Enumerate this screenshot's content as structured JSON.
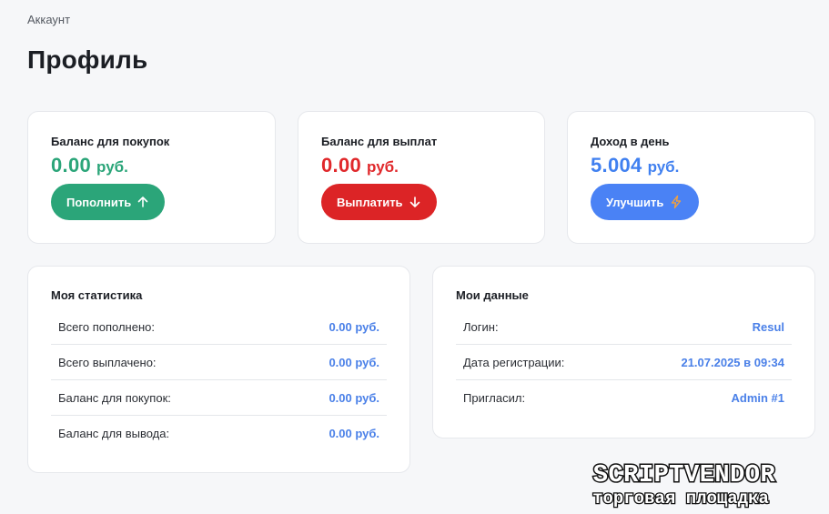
{
  "breadcrumb": "Аккаунт",
  "title": "Профиль",
  "balances": [
    {
      "label": "Баланс для покупок",
      "value": "0.00",
      "unit": "руб.",
      "button": "Пополнить",
      "icon": "arrow-up-icon"
    },
    {
      "label": "Баланс для выплат",
      "value": "0.00",
      "unit": "руб.",
      "button": "Выплатить",
      "icon": "arrow-down-icon"
    },
    {
      "label": "Доход в день",
      "value": "5.004",
      "unit": "руб.",
      "button": "Улучшить",
      "icon": "lightning-icon"
    }
  ],
  "stats": {
    "title": "Моя статистика",
    "rows": [
      {
        "label": "Всего пополнено:",
        "value": "0.00 руб."
      },
      {
        "label": "Всего выплачено:",
        "value": "0.00 руб."
      },
      {
        "label": "Баланс для покупок:",
        "value": "0.00 руб."
      },
      {
        "label": "Баланс для вывода:",
        "value": "0.00 руб."
      }
    ]
  },
  "mydata": {
    "title": "Мои данные",
    "rows": [
      {
        "label": "Логин:",
        "value": "Resul"
      },
      {
        "label": "Дата регистрации:",
        "value": "21.07.2025 в 09:34"
      },
      {
        "label": "Пригласил:",
        "value": "Admin #1"
      }
    ]
  },
  "watermark": {
    "top": "SCRIPTVENDOR",
    "bottom": "торговая площадка"
  },
  "colors": {
    "green": "#2ba579",
    "red": "#dc2426",
    "blue": "#4a82f5",
    "link": "#4a80e8",
    "lightning": "#f0a040"
  }
}
